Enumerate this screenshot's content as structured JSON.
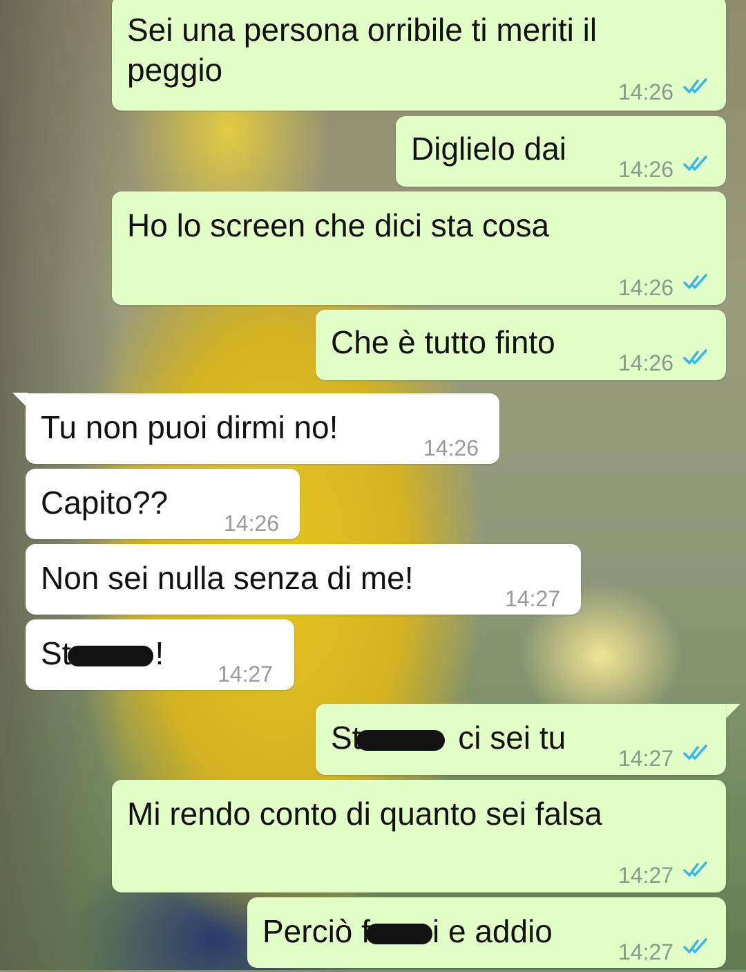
{
  "colors": {
    "outgoing_bubble": "#e1ffc7",
    "incoming_bubble": "#ffffff",
    "read_ticks": "#34b7f1",
    "timestamp": "#8a9a8a"
  },
  "messages": [
    {
      "direction": "out",
      "text": "Sei una persona orribile ti meriti il\npeggio",
      "time": "14:26",
      "status": "read-double-check-icon"
    },
    {
      "direction": "out",
      "text": "Diglielo dai",
      "time": "14:26",
      "status": "read-double-check-icon"
    },
    {
      "direction": "out",
      "text": "Ho lo screen che dici sta cosa",
      "time": "14:26",
      "status": "read-double-check-icon"
    },
    {
      "direction": "out",
      "text": "Che è tutto finto",
      "time": "14:26",
      "status": "read-double-check-icon"
    },
    {
      "direction": "in",
      "text": "Tu non puoi dirmi no!",
      "time": "14:26"
    },
    {
      "direction": "in",
      "text": "Capito??",
      "time": "14:26"
    },
    {
      "direction": "in",
      "text": "Non sei nulla senza di me!",
      "time": "14:27"
    },
    {
      "direction": "in",
      "text_before": "St",
      "text_after": "!",
      "censored": true,
      "time": "14:27"
    },
    {
      "direction": "out",
      "text_before": "St",
      "text_after": " ci sei tu",
      "censored": true,
      "time": "14:27",
      "status": "read-double-check-icon"
    },
    {
      "direction": "out",
      "text": "Mi rendo conto di quanto sei falsa",
      "time": "14:27",
      "status": "read-double-check-icon"
    },
    {
      "direction": "out",
      "text_before": "Perciò f",
      "text_after": "i e addio",
      "censored": true,
      "time": "14:27",
      "status": "read-double-check-icon"
    }
  ]
}
